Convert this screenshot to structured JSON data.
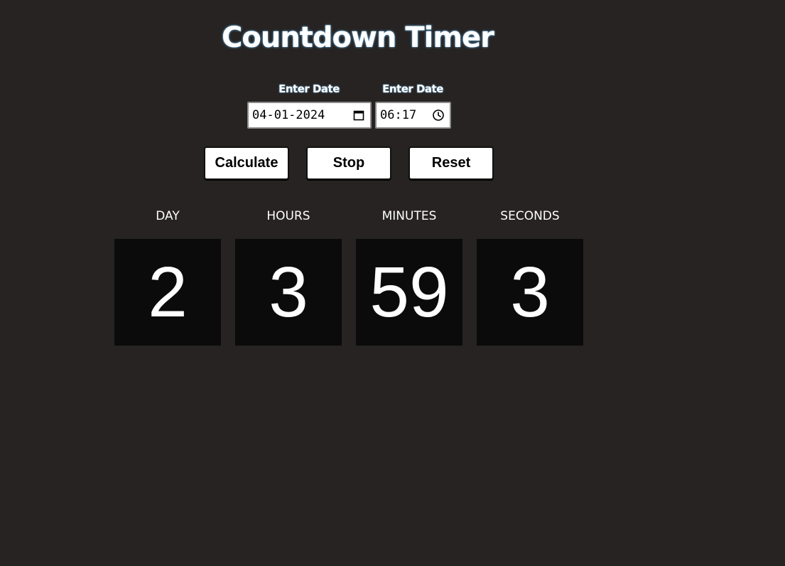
{
  "page": {
    "title": "Countdown Timer",
    "background": "#262322"
  },
  "form": {
    "date_label": "Enter Date",
    "time_label": "Enter Date",
    "date_value": "04-01-2024",
    "time_value": "06:17",
    "date_icon": "calendar-icon",
    "time_icon": "clock-icon"
  },
  "buttons": {
    "calculate": "Calculate",
    "stop": "Stop",
    "reset": "Reset"
  },
  "countdown": {
    "units": [
      {
        "label": "DAY",
        "value": "2"
      },
      {
        "label": "HOURS",
        "value": "3"
      },
      {
        "label": "MINUTES",
        "value": "59"
      },
      {
        "label": "SECONDS",
        "value": "3"
      }
    ],
    "tile_color": "#0b0b0b"
  }
}
